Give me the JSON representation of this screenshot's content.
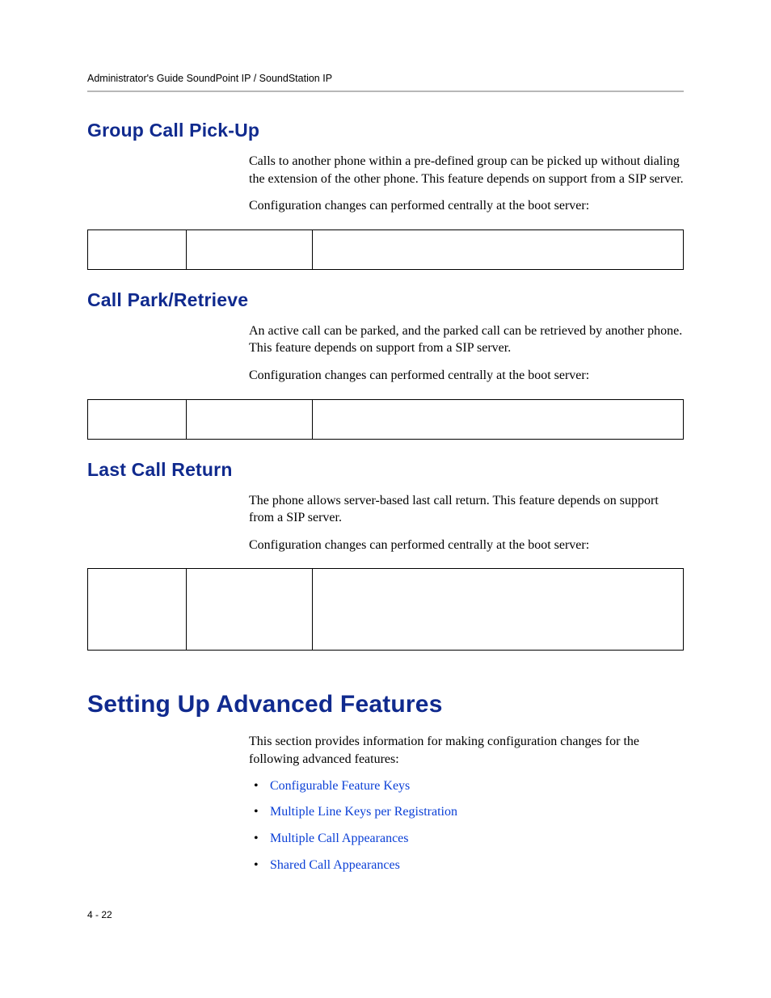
{
  "header": {
    "running_title": "Administrator's Guide SoundPoint IP / SoundStation IP"
  },
  "sections": {
    "groupCallPickup": {
      "title": "Group Call Pick-Up",
      "para1": "Calls to another phone within a pre-defined group can be picked up without dialing the extension of the other phone. This feature depends on support from a SIP server.",
      "para2": "Configuration changes can performed centrally at the boot server:"
    },
    "callParkRetrieve": {
      "title": "Call Park/Retrieve",
      "para1": "An active call can be parked, and the parked call can be retrieved by another phone. This feature depends on support from a SIP server.",
      "para2": "Configuration changes can performed centrally at the boot server:"
    },
    "lastCallReturn": {
      "title": "Last Call Return",
      "para1": "The phone allows server-based last call return. This feature depends on support from a SIP server.",
      "para2": "Configuration changes can performed centrally at the boot server:"
    },
    "settingUpAdvanced": {
      "title": "Setting Up Advanced Features",
      "intro": "This section provides information for making configuration changes for the following advanced features:",
      "links": [
        "Configurable Feature Keys",
        "Multiple Line Keys per Registration",
        "Multiple Call Appearances",
        "Shared Call Appearances"
      ]
    }
  },
  "footer": {
    "page_number": "4 - 22"
  }
}
